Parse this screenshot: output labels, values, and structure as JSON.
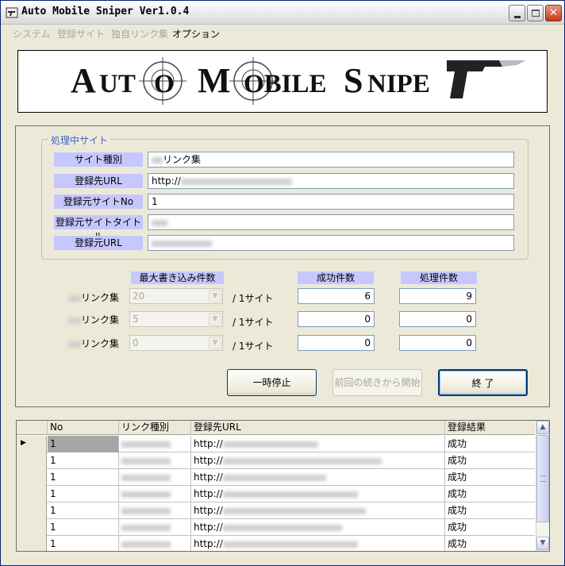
{
  "window": {
    "title": "Auto Mobile Sniper Ver1.0.4",
    "buttons": [
      "minimize",
      "maximize",
      "close"
    ]
  },
  "menu": {
    "items": [
      {
        "label": "システム",
        "enabled": false
      },
      {
        "label": "登録サイト",
        "enabled": false
      },
      {
        "label": "独自リンク集",
        "enabled": false
      },
      {
        "label": "オプション",
        "enabled": true
      }
    ]
  },
  "banner": {
    "logo_text": "AUTO MOBILE SNIPER"
  },
  "processing": {
    "group_title": "処理中サイト",
    "fields": [
      {
        "label": "サイト種別",
        "value": "リンク集",
        "value_prefix_blurred": true
      },
      {
        "label": "登録先URL",
        "value": "http://",
        "value_prefix_blurred": false
      },
      {
        "label": "登録元サイトNo",
        "value": "1",
        "value_prefix_blurred": false
      },
      {
        "label": "登録元サイトタイトル",
        "value": "",
        "value_prefix_blurred": false
      },
      {
        "label": "登録元URL",
        "value": "",
        "value_prefix_blurred": false
      }
    ]
  },
  "counts": {
    "header_max": "最大書き込み件数",
    "header_success": "成功件数",
    "header_processed": "処理件数",
    "per_site": "/ 1サイト",
    "rows": [
      {
        "label": "リンク集",
        "max": "20",
        "success": "6",
        "processed": "9"
      },
      {
        "label": "リンク集",
        "max": "5",
        "success": "0",
        "processed": "0"
      },
      {
        "label": "リンク集",
        "max": "0",
        "success": "0",
        "processed": "0"
      }
    ]
  },
  "buttons": {
    "pause": "一時停止",
    "resume": "前回の続きから開始",
    "exit": "終 了"
  },
  "results_grid": {
    "columns": [
      "No",
      "リンク種別",
      "登録先URL",
      "登録結果"
    ],
    "rows": [
      {
        "no": "1",
        "type": "",
        "url": "http://",
        "result": "成功"
      },
      {
        "no": "1",
        "type": "",
        "url": "http://",
        "result": "成功"
      },
      {
        "no": "1",
        "type": "",
        "url": "http://",
        "result": "成功"
      },
      {
        "no": "1",
        "type": "",
        "url": "http://",
        "result": "成功"
      },
      {
        "no": "1",
        "type": "",
        "url": "http://",
        "result": "成功"
      },
      {
        "no": "1",
        "type": "",
        "url": "http://",
        "result": "成功"
      },
      {
        "no": "1",
        "type": "",
        "url": "http://",
        "result": "成功"
      }
    ]
  },
  "colors": {
    "label_bg": "#c7c7ff",
    "group_title": "#3d63c6",
    "panel_bg": "#ece9d8"
  }
}
